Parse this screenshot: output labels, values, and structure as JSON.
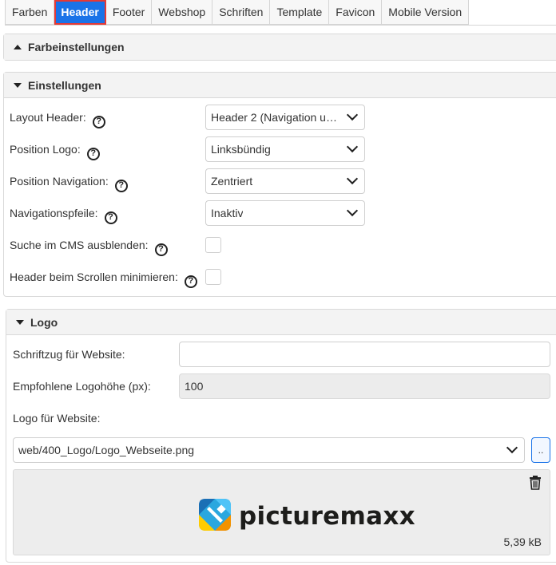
{
  "tabs": [
    "Farben",
    "Header",
    "Footer",
    "Webshop",
    "Schriften",
    "Template",
    "Favicon",
    "Mobile Version"
  ],
  "active_tab": "Header",
  "sections": {
    "farbeinstellungen": {
      "title": "Farbeinstellungen",
      "collapsed": true
    },
    "einstellungen": {
      "title": "Einstellungen",
      "layout_header": {
        "label": "Layout Header:",
        "value": "Header 2 (Navigation un..."
      },
      "position_logo": {
        "label": "Position Logo:",
        "value": "Linksbündig"
      },
      "position_navigation": {
        "label": "Position Navigation:",
        "value": "Zentriert"
      },
      "navigationspfeile": {
        "label": "Navigationspfeile:",
        "value": "Inaktiv"
      },
      "suche_ausblenden": {
        "label": "Suche im CMS ausblenden:",
        "checked": false
      },
      "header_minimieren": {
        "label": "Header beim Scrollen minimieren:",
        "checked": false
      }
    },
    "logo": {
      "title": "Logo",
      "schriftzug": {
        "label": "Schriftzug für Website:",
        "value": ""
      },
      "logohoehe": {
        "label": "Empfohlene Logohöhe (px):",
        "value": "100"
      },
      "logo_website": {
        "label": "Logo für Website:",
        "value": "web/400_Logo/Logo_Webseite.png",
        "browse_label": ".."
      },
      "preview": {
        "logo_text": "picturemaxx",
        "file_size": "5,39 kB"
      }
    }
  },
  "help_glyph": "?",
  "icons": [
    "caret-up-icon",
    "caret-down-icon",
    "help-circle-icon",
    "chevron-down-icon",
    "trash-icon",
    "picturemaxx-logo-icon"
  ]
}
